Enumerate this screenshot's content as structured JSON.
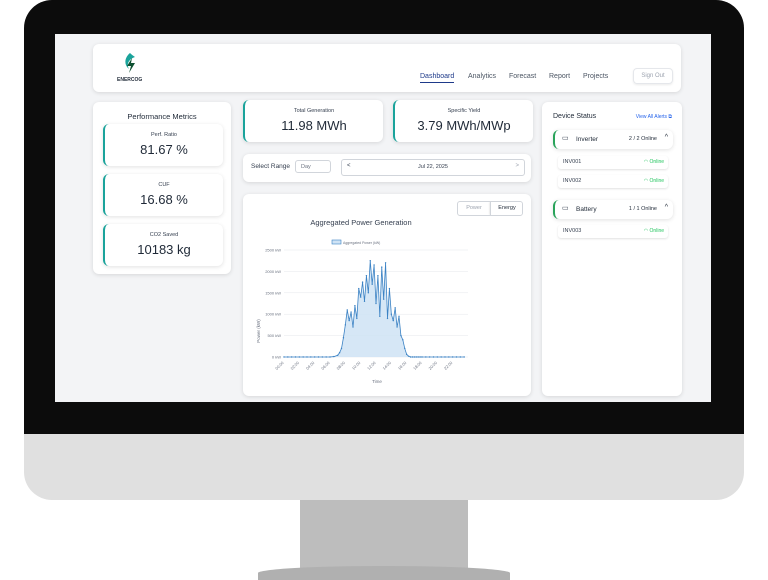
{
  "brand": {
    "name": "ENERCOG"
  },
  "nav": {
    "items": [
      "Dashboard",
      "Analytics",
      "Forecast",
      "Report",
      "Projects"
    ],
    "active": "Dashboard",
    "signout": "Sign Out"
  },
  "performance": {
    "title": "Performance Metrics",
    "metrics": [
      {
        "label": "Perf. Ratio",
        "value": "81.67 %"
      },
      {
        "label": "CUF",
        "value": "16.68 %"
      },
      {
        "label": "CO2 Saved",
        "value": "10183 kg"
      }
    ]
  },
  "summary": {
    "total_generation": {
      "label": "Total Generation",
      "value": "11.98 MWh"
    },
    "specific_yield": {
      "label": "Specific Yield",
      "value": "3.79 MWh/MWp"
    }
  },
  "range": {
    "label": "Select Range",
    "mode": "Day",
    "date": "Jul 22, 2025",
    "prev": "<",
    "next": ">"
  },
  "toggle": {
    "power": "Power",
    "energy": "Energy",
    "selected": "Energy"
  },
  "devices": {
    "title": "Device Status",
    "alerts_link": "View All Alerts",
    "groups": [
      {
        "name": "Inverter",
        "count": "2 / 2 Online",
        "items": [
          {
            "id": "INV001",
            "status": "Online"
          },
          {
            "id": "INV002",
            "status": "Online"
          }
        ]
      },
      {
        "name": "Battery",
        "count": "1 / 1 Online",
        "items": [
          {
            "id": "INV003",
            "status": "Online"
          }
        ]
      }
    ]
  },
  "chart_data": {
    "type": "area",
    "title": "Aggregated Power Generation",
    "xlabel": "Time",
    "ylabel": "Power (kW)",
    "legend": "Aggregated Power (kW)",
    "legend_position": "top",
    "ylim": [
      0,
      2500
    ],
    "yticks": [
      "0 kW",
      "500 kW",
      "1000 kW",
      "1500 kW",
      "2000 kW",
      "2500 kW"
    ],
    "xticks": [
      "00:00",
      "02:00",
      "04:00",
      "06:00",
      "08:00",
      "10:00",
      "12:00",
      "14:00",
      "16:00",
      "18:00",
      "20:00",
      "22:00"
    ],
    "x_hours": [
      0,
      0.5,
      1,
      1.5,
      2,
      2.5,
      3,
      3.5,
      4,
      4.5,
      5,
      5.5,
      6,
      6.5,
      7,
      7.25,
      7.5,
      7.75,
      8,
      8.25,
      8.5,
      8.75,
      9,
      9.25,
      9.5,
      9.75,
      10,
      10.25,
      10.5,
      10.75,
      11,
      11.25,
      11.5,
      11.75,
      12,
      12.25,
      12.5,
      12.75,
      13,
      13.25,
      13.5,
      13.75,
      14,
      14.25,
      14.5,
      14.75,
      15,
      15.25,
      15.5,
      15.75,
      16,
      16.25,
      16.5,
      16.75,
      17,
      17.25,
      17.5,
      17.75,
      18,
      18.5,
      19,
      19.5,
      20,
      20.5,
      21,
      21.5,
      22,
      22.5,
      23,
      23.5
    ],
    "values": [
      0,
      0,
      0,
      0,
      0,
      0,
      0,
      0,
      0,
      0,
      0,
      0,
      0,
      10,
      40,
      100,
      200,
      450,
      750,
      1100,
      850,
      1050,
      700,
      1200,
      900,
      1600,
      1400,
      1750,
      1300,
      1900,
      1500,
      2250,
      1700,
      2150,
      1250,
      1900,
      950,
      2100,
      1350,
      2200,
      900,
      1600,
      1000,
      850,
      1150,
      700,
      950,
      500,
      400,
      200,
      60,
      20,
      0,
      0,
      0,
      0,
      0,
      0,
      0,
      0,
      0,
      0,
      0,
      0,
      0,
      0,
      0,
      0,
      0,
      0
    ],
    "grid": true,
    "color": "#3b82c4"
  }
}
